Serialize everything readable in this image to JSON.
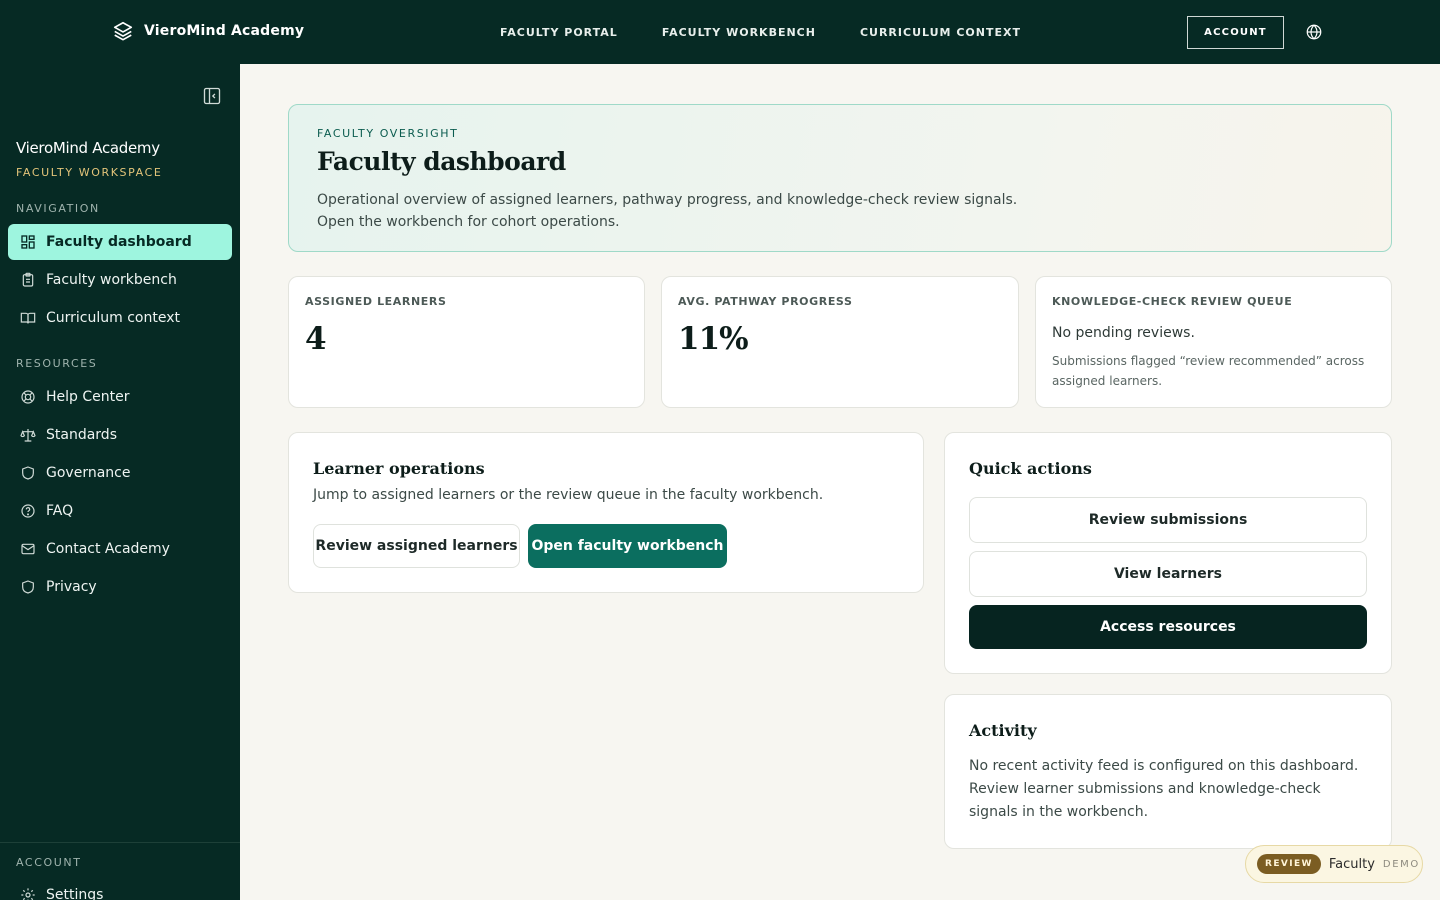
{
  "topbar": {
    "brand": "VieroMind Academy",
    "nav": [
      "FACULTY PORTAL",
      "FACULTY WORKBENCH",
      "CURRICULUM CONTEXT"
    ],
    "account_label": "ACCOUNT"
  },
  "sidebar": {
    "title": "VieroMind Academy",
    "subtitle": "FACULTY WORKSPACE",
    "navigation_heading": "NAVIGATION",
    "navigation": [
      {
        "label": "Faculty dashboard",
        "icon": "dashboard-icon",
        "active": true
      },
      {
        "label": "Faculty workbench",
        "icon": "clipboard-icon"
      },
      {
        "label": "Curriculum context",
        "icon": "book-icon"
      }
    ],
    "resources_heading": "RESOURCES",
    "resources": [
      {
        "label": "Help Center",
        "icon": "lifebuoy-icon"
      },
      {
        "label": "Standards",
        "icon": "scale-icon"
      },
      {
        "label": "Governance",
        "icon": "shield-icon"
      },
      {
        "label": "FAQ",
        "icon": "help-circle-icon"
      },
      {
        "label": "Contact Academy",
        "icon": "mail-icon"
      },
      {
        "label": "Privacy",
        "icon": "shield-icon"
      }
    ],
    "account_heading": "ACCOUNT",
    "account": [
      {
        "label": "Settings",
        "icon": "gear-icon"
      }
    ]
  },
  "hero": {
    "eyebrow": "FACULTY OVERSIGHT",
    "title": "Faculty dashboard",
    "desc_line1": "Operational overview of assigned learners, pathway progress, and knowledge-check review signals.",
    "desc_line2": "Open the workbench for cohort operations."
  },
  "stats": {
    "assigned": {
      "label": "ASSIGNED LEARNERS",
      "value": "4"
    },
    "progress": {
      "label": "AVG. PATHWAY PROGRESS",
      "value": "11%"
    },
    "queue": {
      "label": "KNOWLEDGE-CHECK REVIEW QUEUE",
      "text": "No pending reviews.",
      "note": "Submissions flagged “review recommended” across assigned learners."
    }
  },
  "learner_ops": {
    "title": "Learner operations",
    "desc": "Jump to assigned learners or the review queue in the faculty workbench.",
    "btn_review": "Review assigned learners",
    "btn_open": "Open faculty workbench"
  },
  "quick_actions": {
    "title": "Quick actions",
    "review": "Review submissions",
    "view": "View learners",
    "access": "Access resources"
  },
  "activity": {
    "title": "Activity",
    "text": "No recent activity feed is configured on this dashboard. Review learner submissions and knowledge-check signals in the workbench."
  },
  "badge": {
    "pill": "REVIEW",
    "role": "Faculty",
    "demo": "DEMO"
  },
  "colors": {
    "sidebar_bg": "#062a24",
    "active_item": "#9ef5df",
    "teal_button": "#0b6e5f",
    "dark_button": "#062420",
    "accent_gold": "#e3c47a"
  }
}
